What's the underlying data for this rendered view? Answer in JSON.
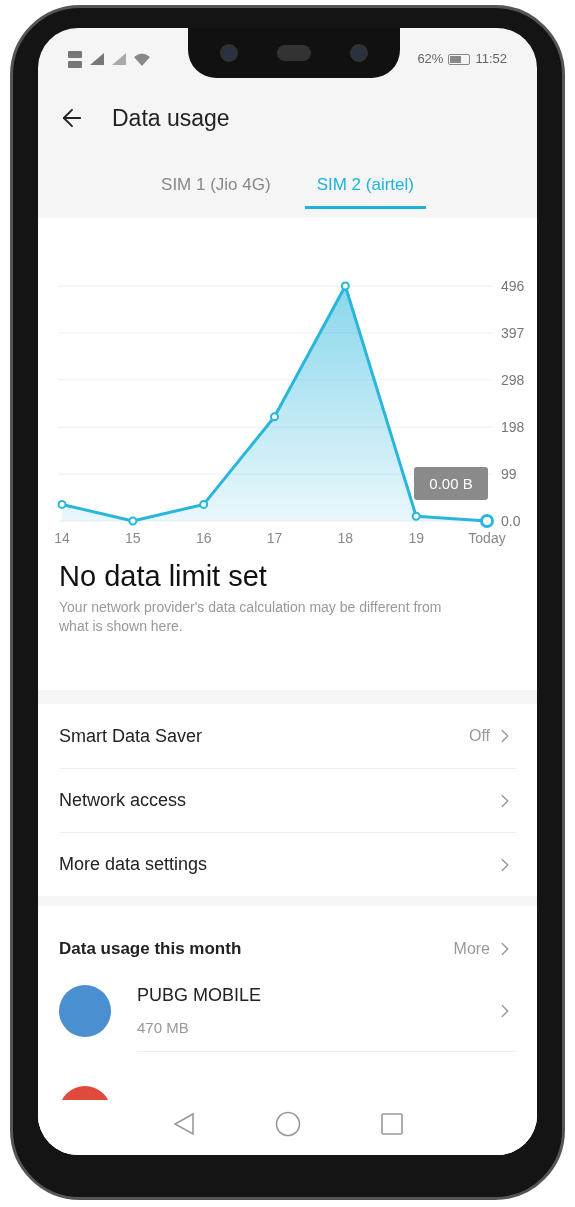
{
  "status_bar": {
    "battery": "62%",
    "time": "11:52"
  },
  "header": {
    "title": "Data usage"
  },
  "tabs": [
    {
      "label": "SIM 1 (Jio 4G)",
      "selected": false
    },
    {
      "label": "SIM 2 (airtel)",
      "selected": true
    }
  ],
  "usage": {
    "chart_data": {
      "type": "area",
      "categories": [
        "14",
        "15",
        "16",
        "17",
        "18",
        "19",
        "Today"
      ],
      "series": [
        {
          "color": "#29b6dc",
          "values": [
            35,
            0,
            35,
            220,
            496,
            10,
            0
          ]
        }
      ],
      "ylim": [
        0,
        496
      ],
      "yticks": [
        {
          "value": 0,
          "label": "0.0"
        },
        {
          "value": 99,
          "label": "99"
        },
        {
          "value": 198,
          "label": "198"
        },
        {
          "value": 298,
          "label": "298"
        },
        {
          "value": 397,
          "label": "397"
        },
        {
          "value": 496,
          "label": "496"
        }
      ],
      "grid": true,
      "annotations": [
        "0.00 B"
      ]
    },
    "title": "No data limit set",
    "note": "Your network provider's data calculation may be different from what is shown here."
  },
  "settings": [
    {
      "label": "Smart Data Saver",
      "value": "Off"
    },
    {
      "label": "Network access"
    },
    {
      "label": "More data settings"
    }
  ],
  "monthly": {
    "title": "Data usage this month",
    "more": "More",
    "apps": [
      {
        "name": "PUBG MOBILE",
        "usage": "470 MB"
      }
    ]
  }
}
